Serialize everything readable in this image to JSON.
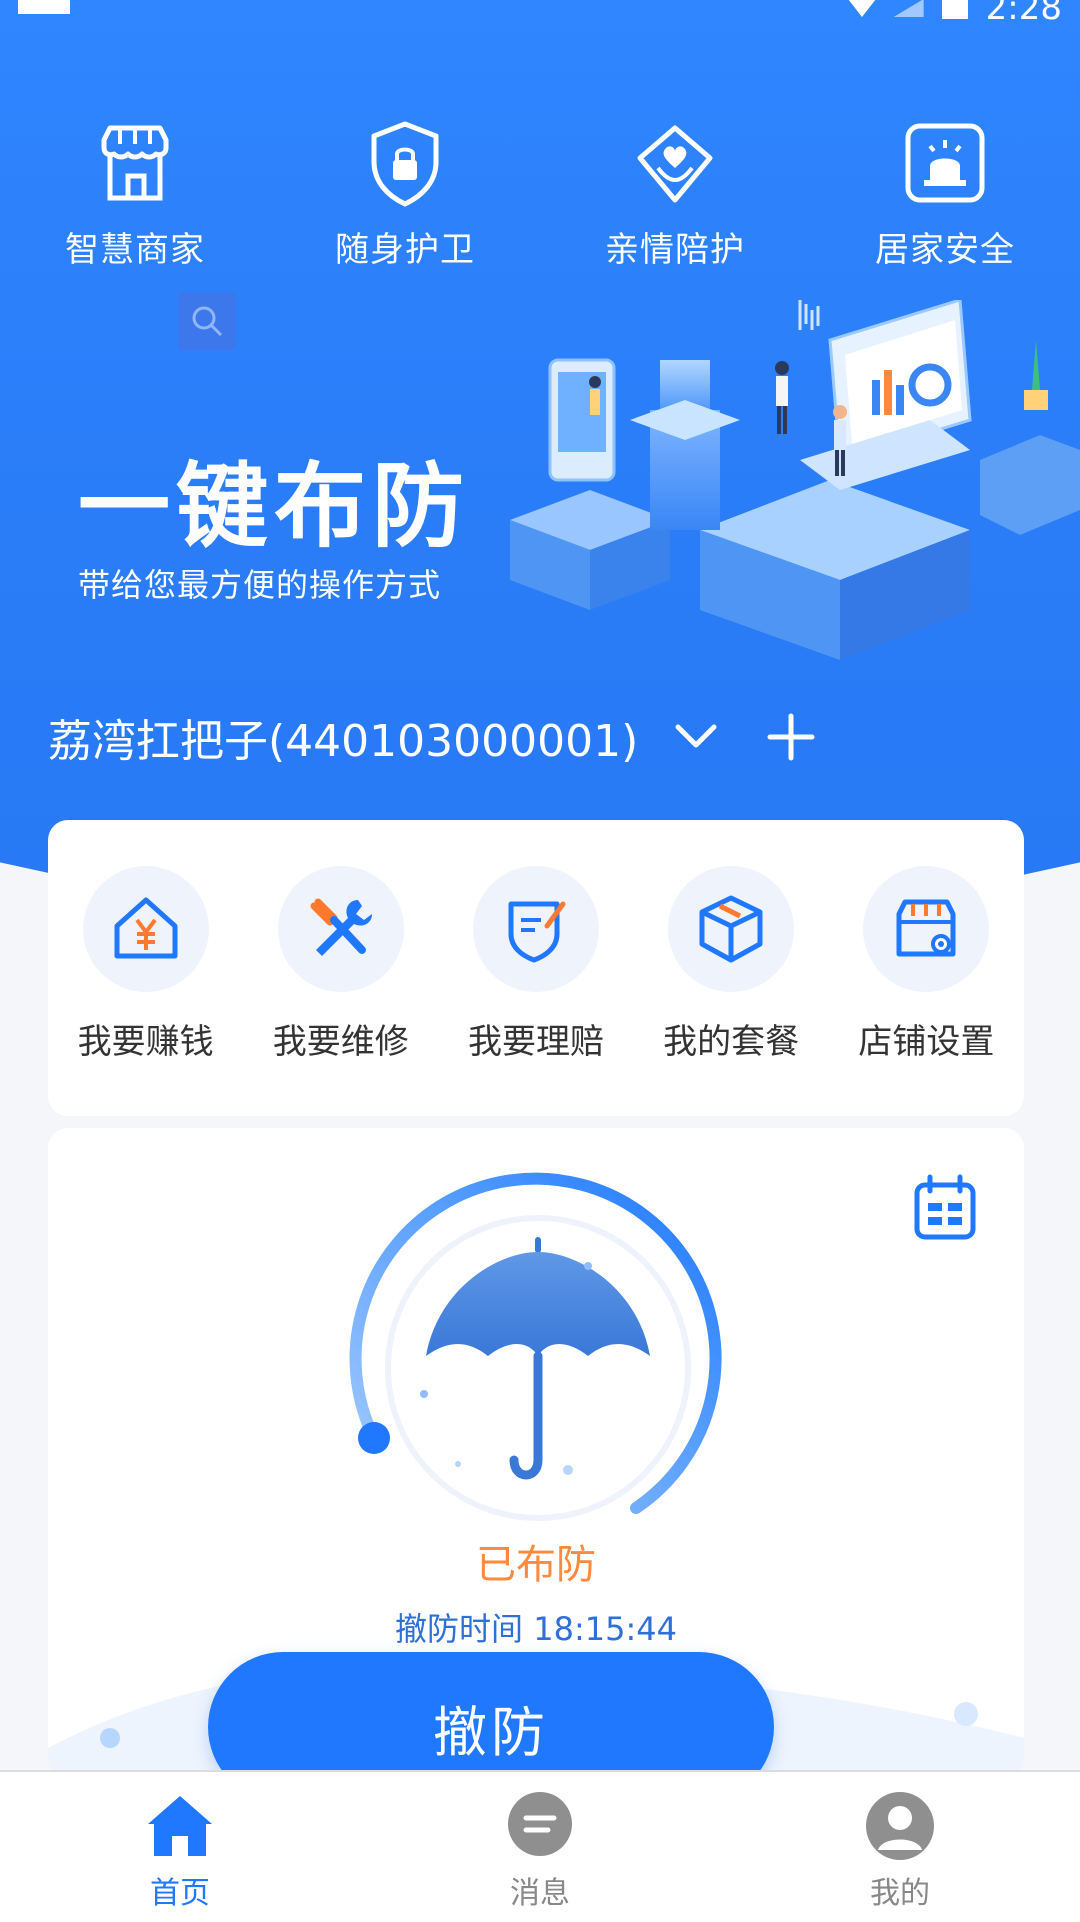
{
  "status_bar": {
    "time": "2:28"
  },
  "features": [
    {
      "label": "智慧商家",
      "icon": "store-icon"
    },
    {
      "label": "随身护卫",
      "icon": "shield-lock-icon"
    },
    {
      "label": "亲情陪护",
      "icon": "heart-hands-icon"
    },
    {
      "label": "居家安全",
      "icon": "alarm-light-icon"
    }
  ],
  "banner": {
    "title": "一键布防",
    "subtitle": "带给您最方便的操作方式"
  },
  "account": {
    "name": "荔湾扛把子(440103000001)"
  },
  "quick_actions": [
    {
      "label": "我要赚钱",
      "icon": "money-house-icon"
    },
    {
      "label": "我要维修",
      "icon": "repair-tools-icon"
    },
    {
      "label": "我要理赔",
      "icon": "claim-shield-icon"
    },
    {
      "label": "我的套餐",
      "icon": "package-box-icon"
    },
    {
      "label": "店铺设置",
      "icon": "shop-settings-icon"
    }
  ],
  "defense": {
    "status": "已布防",
    "time_label": "撤防时间 18:15:44",
    "button_label": "撤防"
  },
  "bottom_nav": [
    {
      "label": "首页",
      "icon": "home-icon",
      "active": true
    },
    {
      "label": "消息",
      "icon": "message-icon",
      "active": false
    },
    {
      "label": "我的",
      "icon": "profile-icon",
      "active": false
    }
  ],
  "colors": {
    "primary": "#1f78ff",
    "hero_bg": "#2f86ff",
    "status_orange": "#ff8a3d"
  }
}
